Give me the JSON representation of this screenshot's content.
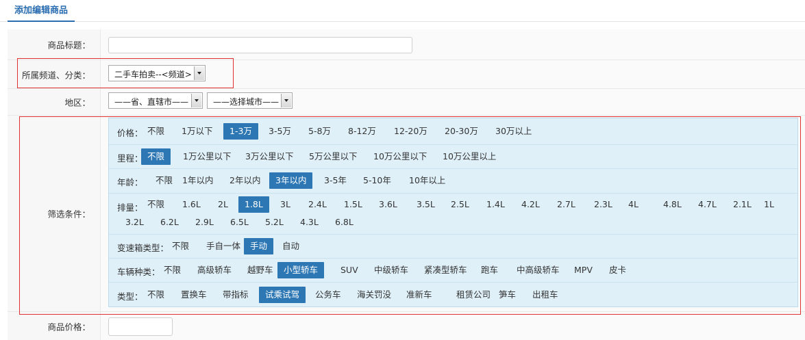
{
  "page": {
    "tab_label": "添加编辑商品"
  },
  "form": {
    "title_label": "商品标题：",
    "title_value": "",
    "channel_label": "所属频道、分类：",
    "channel_value": "二手车拍卖--<频道>",
    "region_label": "地区：",
    "province_value": "——省、直辖市——",
    "city_value": "——选择城市——",
    "filter_label": "筛选条件：",
    "price_label": "商品价格：",
    "price_value": ""
  },
  "filters": [
    {
      "label": "价格：",
      "options": [
        "不限",
        "1万以下",
        "1-3万",
        "3-5万",
        "5-8万",
        "8-12万",
        "12-20万",
        "20-30万",
        "30万以上"
      ],
      "selected": "1-3万"
    },
    {
      "label": "里程：",
      "options": [
        "不限",
        "1万公里以下",
        "3万公里以下",
        "5万公里以下",
        "10万公里以下",
        "10万公里以上"
      ],
      "selected": "不限"
    },
    {
      "label": "年龄：",
      "options": [
        "不限",
        "1年以内",
        "2年以内",
        "3年以内",
        "3-5年",
        "5-10年",
        "10年以上"
      ],
      "selected": "3年以内"
    },
    {
      "label": "排量：",
      "options": [
        "不限",
        "1.6L",
        "2L",
        "1.8L",
        "3L",
        "2.4L",
        "1.5L",
        "3.6L",
        "3.5L",
        "2.5L",
        "1.4L",
        "4.2L",
        "2.7L",
        "2.3L",
        "4L",
        "4.8L",
        "4.7L",
        "2.1L",
        "1L",
        "3.2L",
        "6.2L",
        "2.9L",
        "6.5L",
        "5.2L",
        "4.3L",
        "6.8L"
      ],
      "selected": "1.8L"
    },
    {
      "label": "变速箱类型：",
      "options": [
        "不限",
        "手自一体",
        "手动",
        "自动"
      ],
      "selected": "手动"
    },
    {
      "label": "车辆种类：",
      "options": [
        "不限",
        "高级轿车",
        "越野车",
        "小型轿车",
        "SUV",
        "中级轿车",
        "紧凑型轿车",
        "跑车",
        "中高级轿车",
        "MPV",
        "皮卡"
      ],
      "selected": "小型轿车"
    },
    {
      "label": "类型：",
      "options": [
        "不限",
        "置换车",
        "带指标",
        "试乘试驾",
        "公务车",
        "海关罚没",
        "准新车",
        "租赁公司",
        "笋车",
        "出租车"
      ],
      "selected": "试乘试驾"
    }
  ],
  "colors": {
    "accent": "#2e77b5",
    "highlight_border": "#e03030",
    "panel_bg": "#dff0f8"
  }
}
